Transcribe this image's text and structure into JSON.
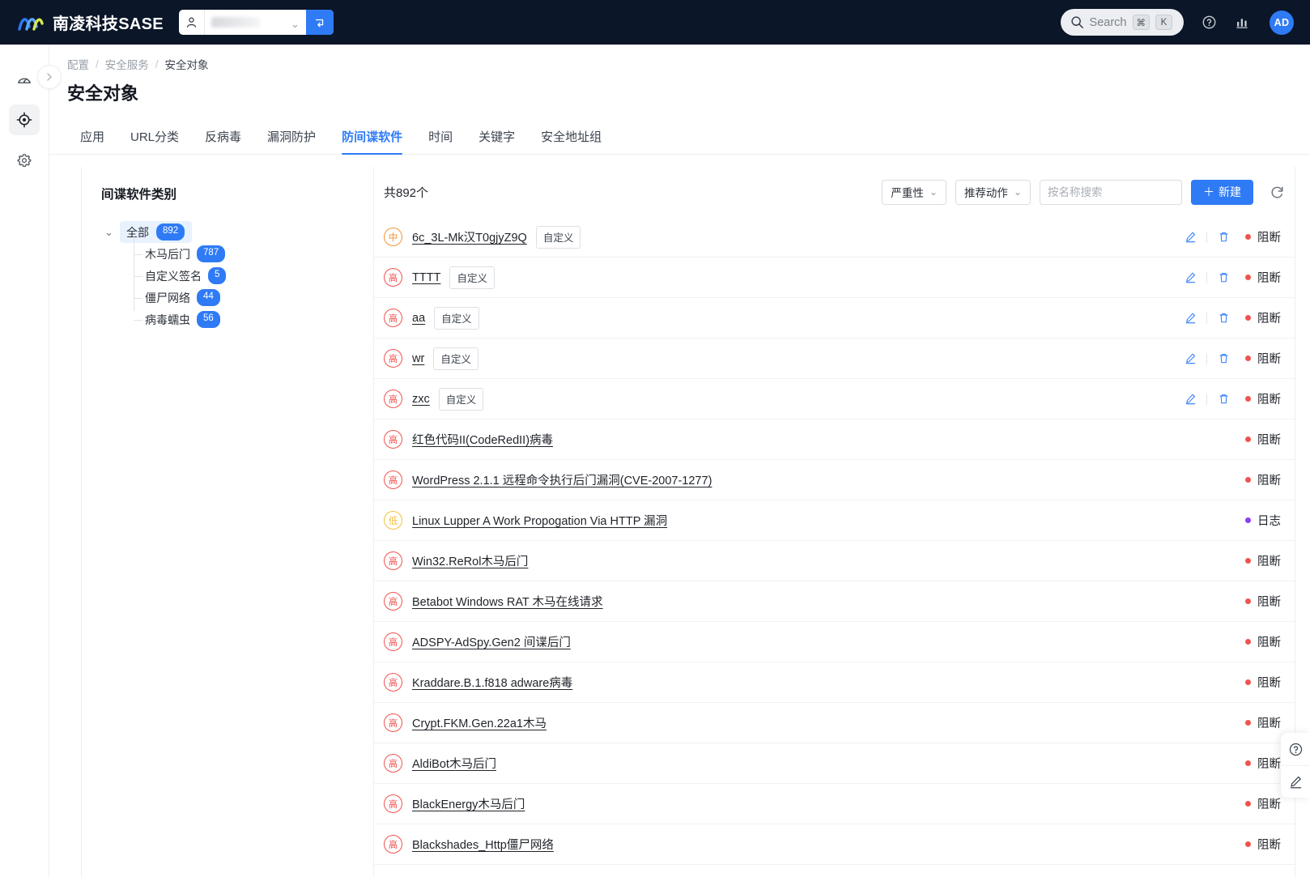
{
  "topbar": {
    "brand_name": "南凌科技SASE",
    "tenant_caret": "⌄",
    "search_label": "Search",
    "kbd_cmd": "⌘",
    "kbd_key": "K",
    "avatar_initials": "AD",
    "accent": "#2f7bf6",
    "bg": "#0b1628"
  },
  "rail": {
    "items": [
      {
        "name": "dashboard",
        "active": false
      },
      {
        "name": "security-target",
        "active": true
      },
      {
        "name": "settings",
        "active": false
      }
    ]
  },
  "breadcrumb": {
    "items": [
      "配置",
      "安全服务",
      "安全对象"
    ],
    "separator": "/"
  },
  "page": {
    "title": "安全对象"
  },
  "tabs": {
    "items": [
      {
        "label": "应用",
        "active": false
      },
      {
        "label": "URL分类",
        "active": false
      },
      {
        "label": "反病毒",
        "active": false
      },
      {
        "label": "漏洞防护",
        "active": false
      },
      {
        "label": "防间谍软件",
        "active": true
      },
      {
        "label": "时间",
        "active": false
      },
      {
        "label": "关键字",
        "active": false
      },
      {
        "label": "安全地址组",
        "active": false
      }
    ]
  },
  "tree": {
    "title": "间谍软件类别",
    "root": {
      "label": "全部",
      "count": "892",
      "expanded": true,
      "caret": "⌄"
    },
    "children": [
      {
        "label": "木马后门",
        "count": "787"
      },
      {
        "label": "自定义签名",
        "count": "5"
      },
      {
        "label": "僵尸网络",
        "count": "44"
      },
      {
        "label": "病毒蠕虫",
        "count": "56"
      }
    ]
  },
  "toolbar": {
    "count_text": "共892个",
    "severity_filter": "严重性",
    "action_filter": "推荐动作",
    "caret": "⌄",
    "search_placeholder": "按名称搜索",
    "search_value": "",
    "new_label": "新建",
    "new_plus": "＋"
  },
  "list": {
    "status_colors": {
      "block": "#f0534f",
      "log": "#8b3ff0"
    },
    "severity_labels": {
      "high": "高",
      "mid": "中",
      "low": "低"
    },
    "rows": [
      {
        "severity": "mid",
        "name": "6c_3L-Mk汉T0gjyZ9Q",
        "chip": "自定义",
        "actions": true,
        "status": "阻断",
        "status_kind": "block"
      },
      {
        "severity": "high",
        "name": "TTTT",
        "chip": "自定义",
        "actions": true,
        "status": "阻断",
        "status_kind": "block"
      },
      {
        "severity": "high",
        "name": "aa",
        "chip": "自定义",
        "actions": true,
        "status": "阻断",
        "status_kind": "block"
      },
      {
        "severity": "high",
        "name": "wr",
        "chip": "自定义",
        "actions": true,
        "status": "阻断",
        "status_kind": "block"
      },
      {
        "severity": "high",
        "name": "zxc",
        "chip": "自定义",
        "actions": true,
        "status": "阻断",
        "status_kind": "block"
      },
      {
        "severity": "high",
        "name": "红色代码II(CodeRedII)病毒",
        "chip": "",
        "actions": false,
        "status": "阻断",
        "status_kind": "block"
      },
      {
        "severity": "high",
        "name": "WordPress 2.1.1 远程命令执行后门漏洞(CVE-2007-1277)",
        "chip": "",
        "actions": false,
        "status": "阻断",
        "status_kind": "block"
      },
      {
        "severity": "low",
        "name": "Linux Lupper A Work Propogation Via HTTP 漏洞",
        "chip": "",
        "actions": false,
        "status": "日志",
        "status_kind": "log"
      },
      {
        "severity": "high",
        "name": "Win32.ReRol木马后门",
        "chip": "",
        "actions": false,
        "status": "阻断",
        "status_kind": "block"
      },
      {
        "severity": "high",
        "name": "Betabot Windows RAT 木马在线请求",
        "chip": "",
        "actions": false,
        "status": "阻断",
        "status_kind": "block"
      },
      {
        "severity": "high",
        "name": "ADSPY-AdSpy.Gen2 间谍后门",
        "chip": "",
        "actions": false,
        "status": "阻断",
        "status_kind": "block"
      },
      {
        "severity": "high",
        "name": "Kraddare.B.1.f818 adware病毒",
        "chip": "",
        "actions": false,
        "status": "阻断",
        "status_kind": "block"
      },
      {
        "severity": "high",
        "name": "Crypt.FKM.Gen.22a1木马",
        "chip": "",
        "actions": false,
        "status": "阻断",
        "status_kind": "block"
      },
      {
        "severity": "high",
        "name": "AldiBot木马后门",
        "chip": "",
        "actions": false,
        "status": "阻断",
        "status_kind": "block"
      },
      {
        "severity": "high",
        "name": "BlackEnergy木马后门",
        "chip": "",
        "actions": false,
        "status": "阻断",
        "status_kind": "block"
      },
      {
        "severity": "high",
        "name": "Blackshades_Http僵尸网络",
        "chip": "",
        "actions": false,
        "status": "阻断",
        "status_kind": "block"
      }
    ]
  },
  "float_widget": {
    "help_name": "help-circle-icon",
    "feedback_name": "edit-pencil-icon"
  }
}
